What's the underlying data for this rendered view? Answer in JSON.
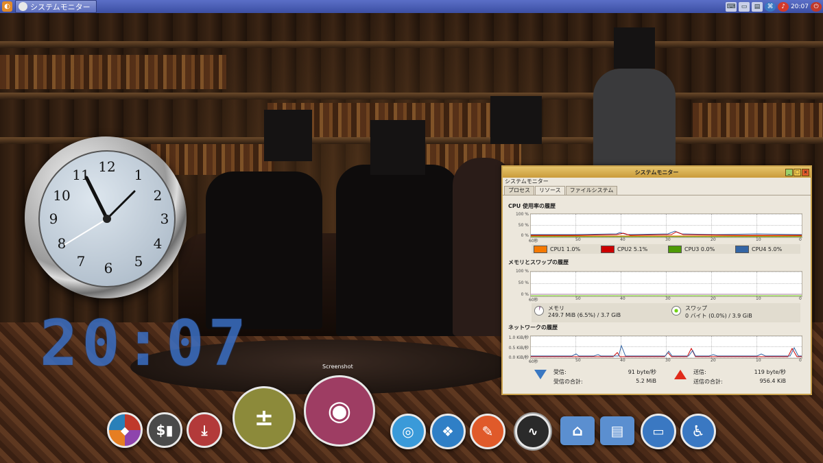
{
  "top_panel": {
    "task_title": "システムモニター",
    "clock": "20:07"
  },
  "desktop": {
    "analog_clock_numbers": [
      "12",
      "1",
      "2",
      "3",
      "4",
      "5",
      "6",
      "7",
      "8",
      "9",
      "10",
      "11"
    ],
    "digital_clock": "20:07",
    "screenshot_label": "Screenshot"
  },
  "sysmon": {
    "title": "システムモニター",
    "menu": "システムモニター",
    "tabs": [
      "プロセス",
      "リソース",
      "ファイルシステム"
    ],
    "cpu": {
      "title": "CPU 使用率の履歴",
      "y_labels": [
        "100 %",
        "50 %",
        "0 %"
      ],
      "x_labels": [
        "60秒",
        "50",
        "40",
        "30",
        "20",
        "10",
        "0"
      ],
      "legend": [
        {
          "label": "CPU1",
          "value": "1.0%",
          "color": "#f57900"
        },
        {
          "label": "CPU2",
          "value": "5.1%",
          "color": "#cc0000"
        },
        {
          "label": "CPU3",
          "value": "0.0%",
          "color": "#4e9a06"
        },
        {
          "label": "CPU4",
          "value": "5.0%",
          "color": "#3465a4"
        }
      ]
    },
    "memory": {
      "title": "メモリとスワップの履歴",
      "y_labels": [
        "100 %",
        "50 %",
        "0 %"
      ],
      "x_labels": [
        "60秒",
        "50",
        "40",
        "30",
        "20",
        "10",
        "0"
      ],
      "mem_label": "メモリ",
      "mem_value": "249.7 MiB (6.5%) / 3.7 GiB",
      "swap_label": "スワップ",
      "swap_value": "0 バイト (0.0%) / 3.9 GiB",
      "mem_color": "#ad7fa8",
      "swap_color": "#73d216"
    },
    "network": {
      "title": "ネットワークの履歴",
      "y_labels": [
        "1.0 KiB/秒",
        "0.5 KiB/秒",
        "0.0 KiB/秒"
      ],
      "x_labels": [
        "60秒",
        "50",
        "40",
        "30",
        "20",
        "10",
        "0"
      ],
      "recv_label": "受信:",
      "recv_rate": "91 byte/秒",
      "recv_total_label": "受信の合計:",
      "recv_total": "5.2 MiB",
      "send_label": "送信:",
      "send_rate": "119 byte/秒",
      "send_total_label": "送信の合計:",
      "send_total": "956.4 KiB"
    }
  },
  "dock": [
    {
      "name": "software-center",
      "color": "#c0392b"
    },
    {
      "name": "finance",
      "color": "#5a5a5a"
    },
    {
      "name": "download",
      "color": "#b33a3a"
    },
    {
      "name": "calculator",
      "color": "#8c8a3a"
    },
    {
      "name": "camera",
      "color": "#9e3d63"
    },
    {
      "name": "chrome",
      "color": "#3a9ad9"
    },
    {
      "name": "dropbox",
      "color": "#2f7fc6"
    },
    {
      "name": "editor",
      "color": "#e05a2a"
    },
    {
      "name": "system-monitor",
      "color": "#2a2a2a"
    },
    {
      "name": "home",
      "color": "#5b8fd0"
    },
    {
      "name": "documents",
      "color": "#5b8fd0"
    },
    {
      "name": "display",
      "color": "#3a78c2"
    },
    {
      "name": "accessibility",
      "color": "#3a78c2"
    }
  ]
}
